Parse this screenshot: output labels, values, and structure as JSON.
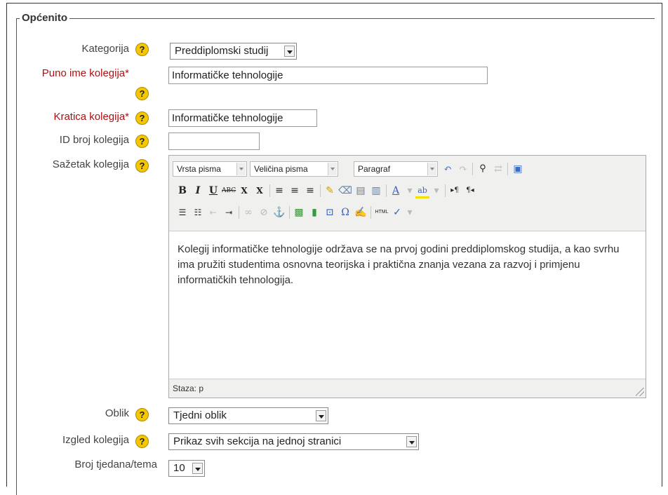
{
  "legend": "Općenito",
  "fields": {
    "category": {
      "label": "Kategorija",
      "value": "Preddiplomski studij"
    },
    "fullname": {
      "label": "Puno ime kolegija",
      "required": "*",
      "value": "Informatičke tehnologije"
    },
    "shortname": {
      "label": "Kratica kolegija",
      "required": "*",
      "value": "Informatičke tehnologije"
    },
    "idnumber": {
      "label": "ID broj kolegija",
      "value": ""
    },
    "summary": {
      "label": "Sažetak kolegija",
      "font_family": "Vrsta pisma",
      "font_size": "Veličina pisma",
      "paragraph": "Paragraf",
      "text": "Kolegij informatičke tehnologije održava se na prvoj godini preddiplomskog studija, a kao svrhu ima pružiti studentima osnovna teorijska i praktična znanja vezana za razvoj i primjenu informatičkih tehnologija.",
      "status": "Staza: p"
    },
    "format": {
      "label": "Oblik",
      "value": "Tjedni oblik"
    },
    "layout": {
      "label": "Izgled kolegija",
      "value": "Prikaz svih sekcija na jednoj stranici"
    },
    "numsections": {
      "label": "Broj tjedana/tema",
      "value": "10"
    }
  },
  "help_glyph": "?",
  "toolbar": {
    "row2": {
      "bold": "B",
      "italic": "I",
      "underline": "U",
      "strike": "ABC",
      "sub": "X",
      "sup": "X"
    },
    "html_label": "HTML"
  },
  "colors": {
    "required": "#aa1111",
    "help": "#f5c700",
    "editor_bg": "#f0f0ee"
  }
}
